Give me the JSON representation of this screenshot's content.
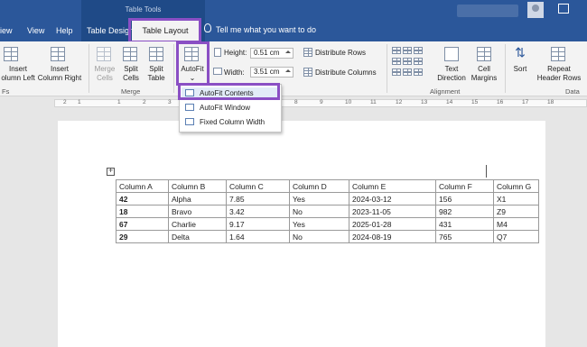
{
  "title_bar": {
    "context_label": "Table Tools",
    "tabs": [
      "iew",
      "View",
      "Help",
      "Table Design",
      "Table Layout"
    ],
    "active_tab": "Table Layout",
    "tell_me": "Tell me what you want to do"
  },
  "ribbon": {
    "insert_left": [
      "Insert",
      "olumn Left"
    ],
    "insert_right": [
      "Insert",
      "Column Right"
    ],
    "merge_cells": [
      "Merge",
      "Cells"
    ],
    "split_cells": [
      "Split",
      "Cells"
    ],
    "split_table": [
      "Split",
      "Table"
    ],
    "merge_group": "Merge",
    "autofit": "AutoFit",
    "height_label": "Height:",
    "height_value": "0.51 cm",
    "width_label": "Width:",
    "width_value": "3.51 cm",
    "distribute_rows": "Distribute Rows",
    "distribute_columns": "Distribute Columns",
    "text_direction": [
      "Text",
      "Direction"
    ],
    "cell_margins": [
      "Cell",
      "Margins"
    ],
    "alignment_group": "Alignment",
    "sort": "Sort",
    "repeat_header": [
      "Repeat",
      "Header Rows"
    ],
    "data_group": "Data",
    "rows_group_short": "Fs"
  },
  "ruler": {
    "marks": [
      "2",
      "1",
      "1",
      "2",
      "3",
      "4",
      "5",
      "6",
      "7",
      "8",
      "9",
      "10",
      "11",
      "12",
      "13",
      "14",
      "15",
      "16",
      "17",
      "18"
    ]
  },
  "autofit_menu": {
    "items": [
      "AutoFit Contents",
      "AutoFit Window",
      "Fixed Column Width"
    ],
    "highlighted": "AutoFit Contents"
  },
  "table": {
    "headers": [
      "Column A",
      "Column B",
      "Column C",
      "Column D",
      "Column E",
      "Column F",
      "Column G"
    ],
    "rows": [
      [
        "42",
        "Alpha",
        "7.85",
        "Yes",
        "2024-03-12",
        "156",
        "X1"
      ],
      [
        "18",
        "Bravo",
        "3.42",
        "No",
        "2023-11-05",
        "982",
        "Z9"
      ],
      [
        "67",
        "Charlie",
        "9.17",
        "Yes",
        "2025-01-28",
        "431",
        "M4"
      ],
      [
        "29",
        "Delta",
        "1.64",
        "No",
        "2024-08-19",
        "765",
        "Q7"
      ]
    ]
  },
  "colors": {
    "title_bar": "#2b579a",
    "highlight_box": "#8a4fc4",
    "ribbon": "#f3f3f3"
  },
  "icons": [
    "bulb-icon",
    "avatar-icon",
    "restore-window-icon",
    "table-move-handle-icon"
  ]
}
